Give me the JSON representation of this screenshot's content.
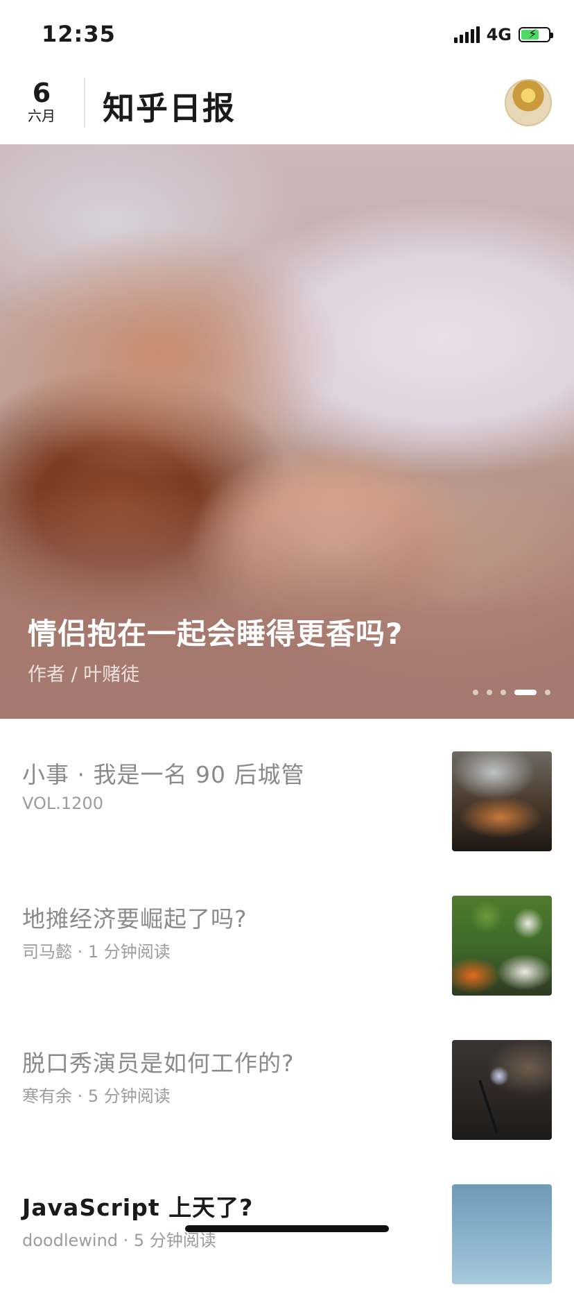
{
  "status_bar": {
    "time": "12:35",
    "network": "4G",
    "icons": [
      "signal-icon",
      "battery-charging-icon"
    ]
  },
  "header": {
    "day": "6",
    "month": "六月",
    "title": "知乎日报",
    "avatar_icon": "avatar-icon"
  },
  "hero": {
    "title": "情侣抱在一起会睡得更香吗?",
    "author": "作者 / 叶赌徒",
    "slide_count": 5,
    "active_slide": 4
  },
  "articles": [
    {
      "title": "小事 · 我是一名 90 后城管",
      "meta": "VOL.1200",
      "thumb": "bbq-grill-photo"
    },
    {
      "title": "地摊经济要崛起了吗?",
      "meta": "司马懿 · 1 分钟阅读",
      "thumb": "vegetables-photo"
    },
    {
      "title": "脱口秀演员是如何工作的?",
      "meta": "寒有余 · 5 分钟阅读",
      "thumb": "microphone-photo"
    },
    {
      "title": "JavaScript 上天了?",
      "meta": "doodlewind · 5 分钟阅读",
      "thumb": "sky-photo"
    }
  ]
}
